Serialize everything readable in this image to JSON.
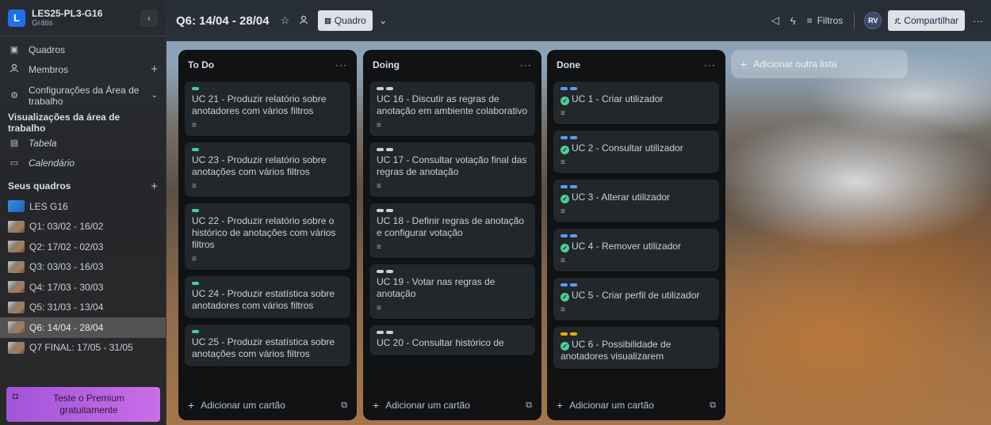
{
  "workspace": {
    "logo_letter": "L",
    "name": "LES25-PL3-G16",
    "plan": "Grátis",
    "collapse": "‹"
  },
  "sidebar": {
    "nav": [
      {
        "label": "Quadros",
        "icon": "board-icon"
      },
      {
        "label": "Membros",
        "icon": "person-icon"
      }
    ],
    "settings_label": "Configurações da Área de trabalho",
    "views_title": "Visualizações da área de trabalho",
    "views": [
      {
        "label": "Tabela",
        "icon": "table-icon"
      },
      {
        "label": "Calendário",
        "icon": "calendar-icon"
      }
    ],
    "boards_title": "Seus quadros",
    "boards": [
      {
        "label": "LES G16",
        "thumb": "blue"
      },
      {
        "label": "Q1: 03/02 - 16/02"
      },
      {
        "label": "Q2: 17/02 - 02/03"
      },
      {
        "label": "Q3: 03/03 - 16/03"
      },
      {
        "label": "Q4: 17/03 - 30/03"
      },
      {
        "label": "Q5: 31/03 - 13/04"
      },
      {
        "label": "Q6: 14/04 - 28/04",
        "active": true
      },
      {
        "label": "Q7 FINAL: 17/05 - 31/05"
      }
    ],
    "premium_label": "Teste o Premium gratuitamente"
  },
  "topbar": {
    "title": "Q6: 14/04 - 28/04",
    "view_label": "Quadro",
    "filters_label": "Filtros",
    "avatar_initials": "RV",
    "share_label": "Compartilhar"
  },
  "lists": [
    {
      "title": "To Do",
      "add_card_label": "Adicionar um cartão",
      "cards": [
        {
          "title": "UC 21 - Produzir relatório sobre anotadores com vários filtros",
          "label_color": "green"
        },
        {
          "title": "UC 23 - Produzir relatório sobre anotações com vários filtros",
          "label_color": "green"
        },
        {
          "title": "UC 22 - Produzir relatório sobre o histórico de anotações com vários filtros",
          "label_color": "green"
        },
        {
          "title": "UC 24 - Produzir estatística sobre anotadores com vários filtros",
          "label_color": "green"
        },
        {
          "title": "UC 25 - Produzir estatística sobre anotações com vários filtros",
          "label_color": "green"
        }
      ]
    },
    {
      "title": "Doing",
      "add_card_label": "Adicionar um cartão",
      "cards": [
        {
          "title": "UC 16 - Discutir as regras de anotação em ambiente colaborativo",
          "label_color": "gray"
        },
        {
          "title": "UC 17 - Consultar votação final das regras de anotação",
          "label_color": "gray"
        },
        {
          "title": "UC 18 - Definir regras de anotação e configurar votação",
          "label_color": "gray"
        },
        {
          "title": "UC 19 - Votar nas regras de anotação",
          "label_color": "gray"
        },
        {
          "title": "UC 20 - Consultar histórico de",
          "label_color": "gray"
        }
      ]
    },
    {
      "title": "Done",
      "add_card_label": "Adicionar um cartão",
      "cards": [
        {
          "title": "UC 1 - Criar utilizador",
          "label_color": "blue",
          "done": true
        },
        {
          "title": "UC 2 - Consultar utilizador",
          "label_color": "blue",
          "done": true
        },
        {
          "title": "UC 3 - Alterar utilizador",
          "label_color": "blue",
          "done": true
        },
        {
          "title": "UC 4 - Remover utilizador",
          "label_color": "blue",
          "done": true
        },
        {
          "title": "UC 5 - Criar perfil de utilizador",
          "label_color": "blue",
          "done": true
        },
        {
          "title": "UC 6 - Possibilidade de anotadores visualizarem",
          "label_color": "yellow",
          "done": true
        }
      ]
    }
  ],
  "add_list_label": "Adicionar outra lista",
  "colors": {
    "label_green": "#4bce97",
    "label_gray": "#c7d1db",
    "label_blue": "#579dff",
    "label_yellow": "#e2b203",
    "premium": "#b862e0"
  }
}
